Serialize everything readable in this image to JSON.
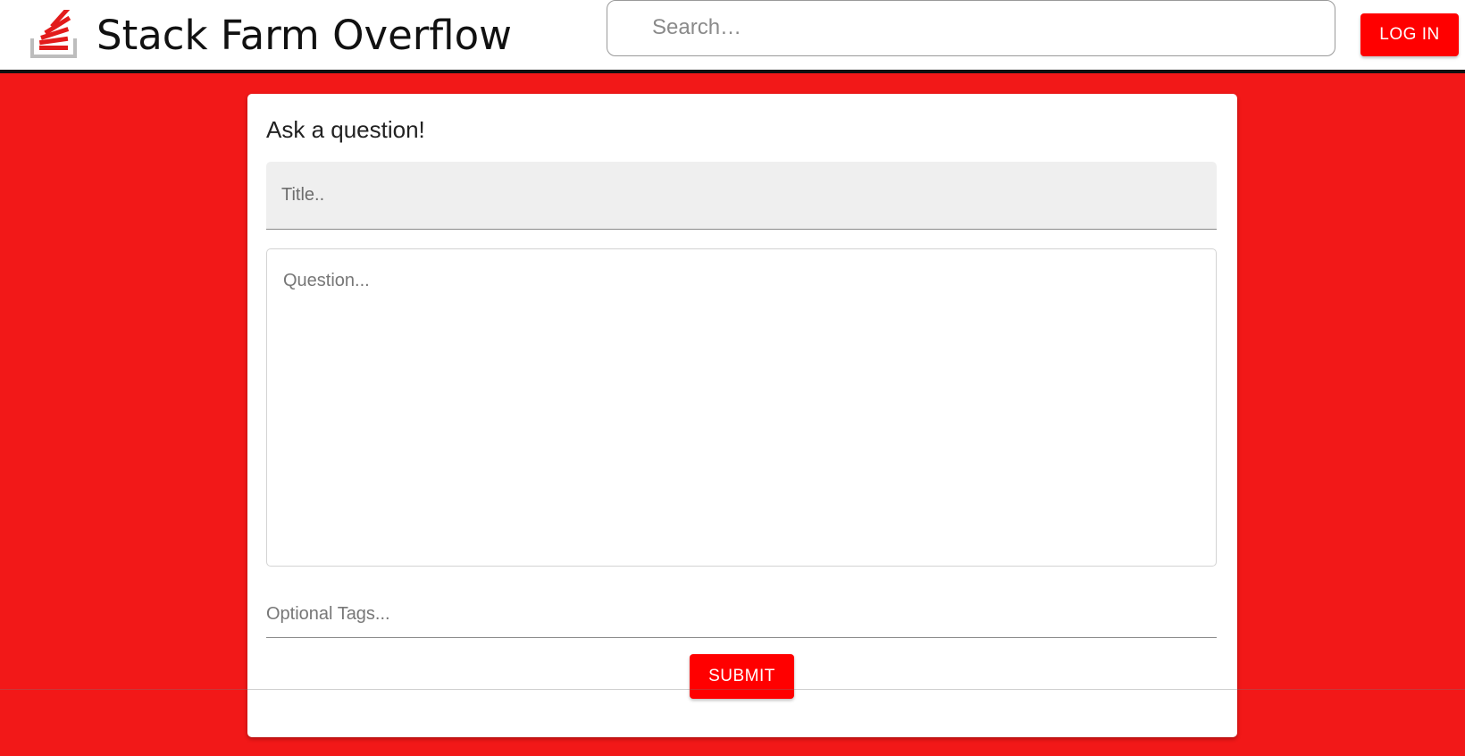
{
  "header": {
    "brand_title": "Stack Farm Overflow",
    "logo_icon": "stacked-papers-logo-icon",
    "search_placeholder": "Search…",
    "login_label": "LOG IN"
  },
  "form": {
    "heading": "Ask a question!",
    "title_placeholder": "Title..",
    "question_placeholder": "Question...",
    "tags_placeholder": "Optional Tags...",
    "submit_label": "SUBMIT"
  },
  "colors": {
    "background": "#f21818",
    "accent": "#ff0000",
    "header_border": "#111111"
  }
}
